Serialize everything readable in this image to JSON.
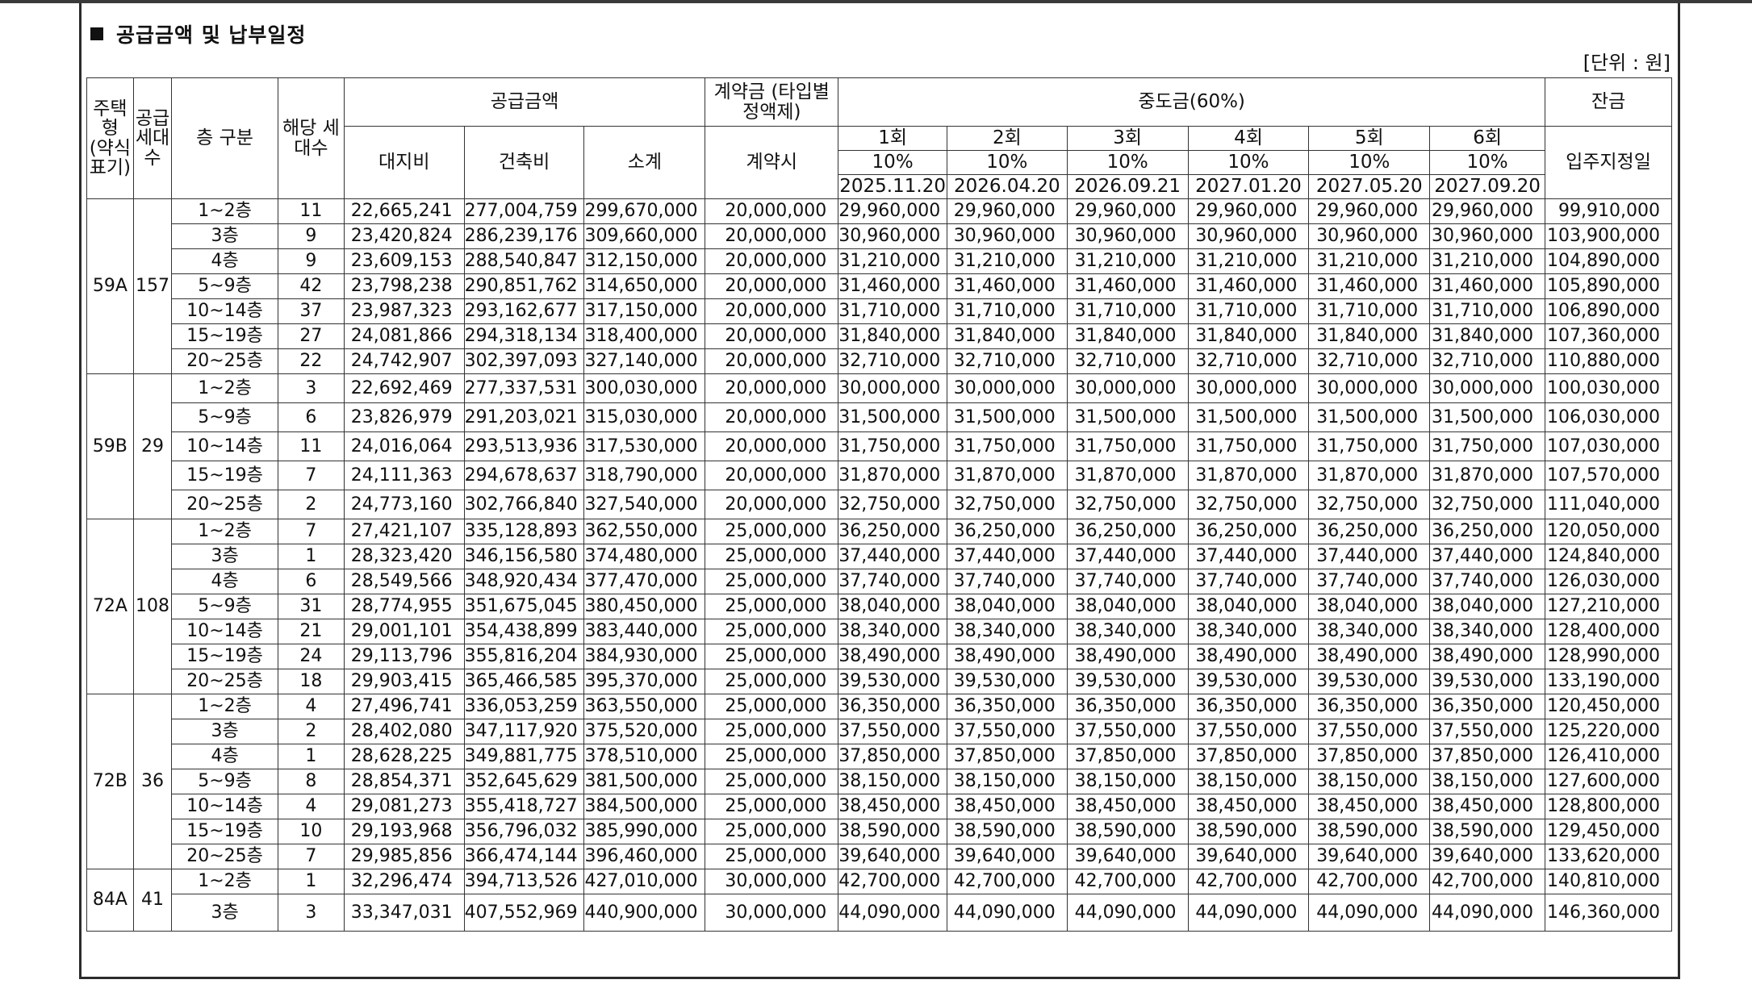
{
  "section_title": "공급금액 및 납부일정",
  "unit_note": "[단위 : 원]",
  "headers": {
    "housing_type": "주택형 (약식 표기)",
    "supply_units": "공급세대수",
    "floor_category": "층 구분",
    "corresponding_units": "해당 세대수",
    "supply_amount": "공급금액",
    "land_cost": "대지비",
    "building_cost": "건축비",
    "subtotal": "소계",
    "deposit": "계약금 (타입별 정액제)",
    "deposit_sub": "계약시",
    "interim": "중도금(60%)",
    "interim_rounds": [
      {
        "label": "1회",
        "pct": "10%",
        "date": "2025.11.20"
      },
      {
        "label": "2회",
        "pct": "10%",
        "date": "2026.04.20"
      },
      {
        "label": "3회",
        "pct": "10%",
        "date": "2026.09.21"
      },
      {
        "label": "4회",
        "pct": "10%",
        "date": "2027.01.20"
      },
      {
        "label": "5회",
        "pct": "10%",
        "date": "2027.05.20"
      },
      {
        "label": "6회",
        "pct": "10%",
        "date": "2027.09.20"
      }
    ],
    "balance": "잔금",
    "balance_sub": "입주지정일"
  },
  "groups": [
    {
      "type": "59A",
      "units": "157",
      "rows": [
        {
          "floor": "1~2층",
          "count": "11",
          "land": "22,665,241",
          "building": "277,004,759",
          "subtotal": "299,670,000",
          "deposit": "20,000,000",
          "interim": "29,960,000",
          "balance": "99,910,000"
        },
        {
          "floor": "3층",
          "count": "9",
          "land": "23,420,824",
          "building": "286,239,176",
          "subtotal": "309,660,000",
          "deposit": "20,000,000",
          "interim": "30,960,000",
          "balance": "103,900,000"
        },
        {
          "floor": "4층",
          "count": "9",
          "land": "23,609,153",
          "building": "288,540,847",
          "subtotal": "312,150,000",
          "deposit": "20,000,000",
          "interim": "31,210,000",
          "balance": "104,890,000"
        },
        {
          "floor": "5~9층",
          "count": "42",
          "land": "23,798,238",
          "building": "290,851,762",
          "subtotal": "314,650,000",
          "deposit": "20,000,000",
          "interim": "31,460,000",
          "balance": "105,890,000"
        },
        {
          "floor": "10~14층",
          "count": "37",
          "land": "23,987,323",
          "building": "293,162,677",
          "subtotal": "317,150,000",
          "deposit": "20,000,000",
          "interim": "31,710,000",
          "balance": "106,890,000"
        },
        {
          "floor": "15~19층",
          "count": "27",
          "land": "24,081,866",
          "building": "294,318,134",
          "subtotal": "318,400,000",
          "deposit": "20,000,000",
          "interim": "31,840,000",
          "balance": "107,360,000"
        },
        {
          "floor": "20~25층",
          "count": "22",
          "land": "24,742,907",
          "building": "302,397,093",
          "subtotal": "327,140,000",
          "deposit": "20,000,000",
          "interim": "32,710,000",
          "balance": "110,880,000"
        }
      ]
    },
    {
      "type": "59B",
      "units": "29",
      "rows": [
        {
          "floor": "1~2층",
          "count": "3",
          "land": "22,692,469",
          "building": "277,337,531",
          "subtotal": "300,030,000",
          "deposit": "20,000,000",
          "interim": "30,000,000",
          "balance": "100,030,000"
        },
        {
          "floor": "5~9층",
          "count": "6",
          "land": "23,826,979",
          "building": "291,203,021",
          "subtotal": "315,030,000",
          "deposit": "20,000,000",
          "interim": "31,500,000",
          "balance": "106,030,000"
        },
        {
          "floor": "10~14층",
          "count": "11",
          "land": "24,016,064",
          "building": "293,513,936",
          "subtotal": "317,530,000",
          "deposit": "20,000,000",
          "interim": "31,750,000",
          "balance": "107,030,000"
        },
        {
          "floor": "15~19층",
          "count": "7",
          "land": "24,111,363",
          "building": "294,678,637",
          "subtotal": "318,790,000",
          "deposit": "20,000,000",
          "interim": "31,870,000",
          "balance": "107,570,000"
        },
        {
          "floor": "20~25층",
          "count": "2",
          "land": "24,773,160",
          "building": "302,766,840",
          "subtotal": "327,540,000",
          "deposit": "20,000,000",
          "interim": "32,750,000",
          "balance": "111,040,000"
        }
      ]
    },
    {
      "type": "72A",
      "units": "108",
      "rows": [
        {
          "floor": "1~2층",
          "count": "7",
          "land": "27,421,107",
          "building": "335,128,893",
          "subtotal": "362,550,000",
          "deposit": "25,000,000",
          "interim": "36,250,000",
          "balance": "120,050,000"
        },
        {
          "floor": "3층",
          "count": "1",
          "land": "28,323,420",
          "building": "346,156,580",
          "subtotal": "374,480,000",
          "deposit": "25,000,000",
          "interim": "37,440,000",
          "balance": "124,840,000"
        },
        {
          "floor": "4층",
          "count": "6",
          "land": "28,549,566",
          "building": "348,920,434",
          "subtotal": "377,470,000",
          "deposit": "25,000,000",
          "interim": "37,740,000",
          "balance": "126,030,000"
        },
        {
          "floor": "5~9층",
          "count": "31",
          "land": "28,774,955",
          "building": "351,675,045",
          "subtotal": "380,450,000",
          "deposit": "25,000,000",
          "interim": "38,040,000",
          "balance": "127,210,000"
        },
        {
          "floor": "10~14층",
          "count": "21",
          "land": "29,001,101",
          "building": "354,438,899",
          "subtotal": "383,440,000",
          "deposit": "25,000,000",
          "interim": "38,340,000",
          "balance": "128,400,000"
        },
        {
          "floor": "15~19층",
          "count": "24",
          "land": "29,113,796",
          "building": "355,816,204",
          "subtotal": "384,930,000",
          "deposit": "25,000,000",
          "interim": "38,490,000",
          "balance": "128,990,000"
        },
        {
          "floor": "20~25층",
          "count": "18",
          "land": "29,903,415",
          "building": "365,466,585",
          "subtotal": "395,370,000",
          "deposit": "25,000,000",
          "interim": "39,530,000",
          "balance": "133,190,000"
        }
      ]
    },
    {
      "type": "72B",
      "units": "36",
      "rows": [
        {
          "floor": "1~2층",
          "count": "4",
          "land": "27,496,741",
          "building": "336,053,259",
          "subtotal": "363,550,000",
          "deposit": "25,000,000",
          "interim": "36,350,000",
          "balance": "120,450,000"
        },
        {
          "floor": "3층",
          "count": "2",
          "land": "28,402,080",
          "building": "347,117,920",
          "subtotal": "375,520,000",
          "deposit": "25,000,000",
          "interim": "37,550,000",
          "balance": "125,220,000"
        },
        {
          "floor": "4층",
          "count": "1",
          "land": "28,628,225",
          "building": "349,881,775",
          "subtotal": "378,510,000",
          "deposit": "25,000,000",
          "interim": "37,850,000",
          "balance": "126,410,000"
        },
        {
          "floor": "5~9층",
          "count": "8",
          "land": "28,854,371",
          "building": "352,645,629",
          "subtotal": "381,500,000",
          "deposit": "25,000,000",
          "interim": "38,150,000",
          "balance": "127,600,000"
        },
        {
          "floor": "10~14층",
          "count": "4",
          "land": "29,081,273",
          "building": "355,418,727",
          "subtotal": "384,500,000",
          "deposit": "25,000,000",
          "interim": "38,450,000",
          "balance": "128,800,000"
        },
        {
          "floor": "15~19층",
          "count": "10",
          "land": "29,193,968",
          "building": "356,796,032",
          "subtotal": "385,990,000",
          "deposit": "25,000,000",
          "interim": "38,590,000",
          "balance": "129,450,000"
        },
        {
          "floor": "20~25층",
          "count": "7",
          "land": "29,985,856",
          "building": "366,474,144",
          "subtotal": "396,460,000",
          "deposit": "25,000,000",
          "interim": "39,640,000",
          "balance": "133,620,000"
        }
      ]
    },
    {
      "type": "84A",
      "units": "41",
      "rows": [
        {
          "floor": "1~2층",
          "count": "1",
          "land": "32,296,474",
          "building": "394,713,526",
          "subtotal": "427,010,000",
          "deposit": "30,000,000",
          "interim": "42,700,000",
          "balance": "140,810,000"
        },
        {
          "floor": "3층",
          "count": "3",
          "land": "33,347,031",
          "building": "407,552,969",
          "subtotal": "440,900,000",
          "deposit": "30,000,000",
          "interim": "44,090,000",
          "balance": "146,360,000"
        }
      ]
    }
  ]
}
